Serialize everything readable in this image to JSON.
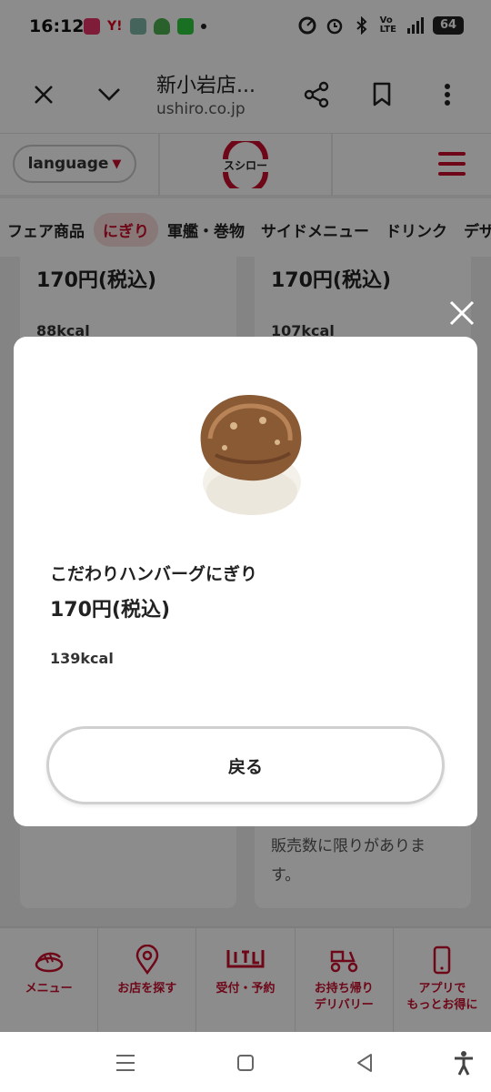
{
  "status_bar": {
    "time": "16:12",
    "battery": "64"
  },
  "browser": {
    "title": "新小岩店...",
    "url": "ushiro.co.jp"
  },
  "header": {
    "language_label": "language",
    "logo_text": "スシロー"
  },
  "category_tabs": [
    {
      "label": "フェア商品"
    },
    {
      "label": "にぎり"
    },
    {
      "label": "軍艦・巻物"
    },
    {
      "label": "サイドメニュー"
    },
    {
      "label": "ドリンク"
    },
    {
      "label": "デザ"
    }
  ],
  "background_cards": [
    {
      "price": "170円(税込)",
      "kcal": "88kcal",
      "note": ""
    },
    {
      "price": "170円(税込)",
      "kcal": "107kcal",
      "note": "販売数に限りがあります。"
    }
  ],
  "modal": {
    "name": "こだわりハンバーグにぎり",
    "price": "170円(税込)",
    "kcal": "139kcal",
    "back_label": "戻る"
  },
  "bottom_nav": [
    {
      "label": "メニュー",
      "icon": "sushi-icon"
    },
    {
      "label": "お店を探す",
      "icon": "location-pin-icon"
    },
    {
      "label": "受付・予約",
      "icon": "reception-icon"
    },
    {
      "label": "お持ち帰り\nデリバリー",
      "icon": "delivery-scooter-icon"
    },
    {
      "label": "アプリで\nもっとお得に",
      "icon": "smartphone-icon"
    }
  ],
  "colors": {
    "brand_red": "#c8102e"
  }
}
